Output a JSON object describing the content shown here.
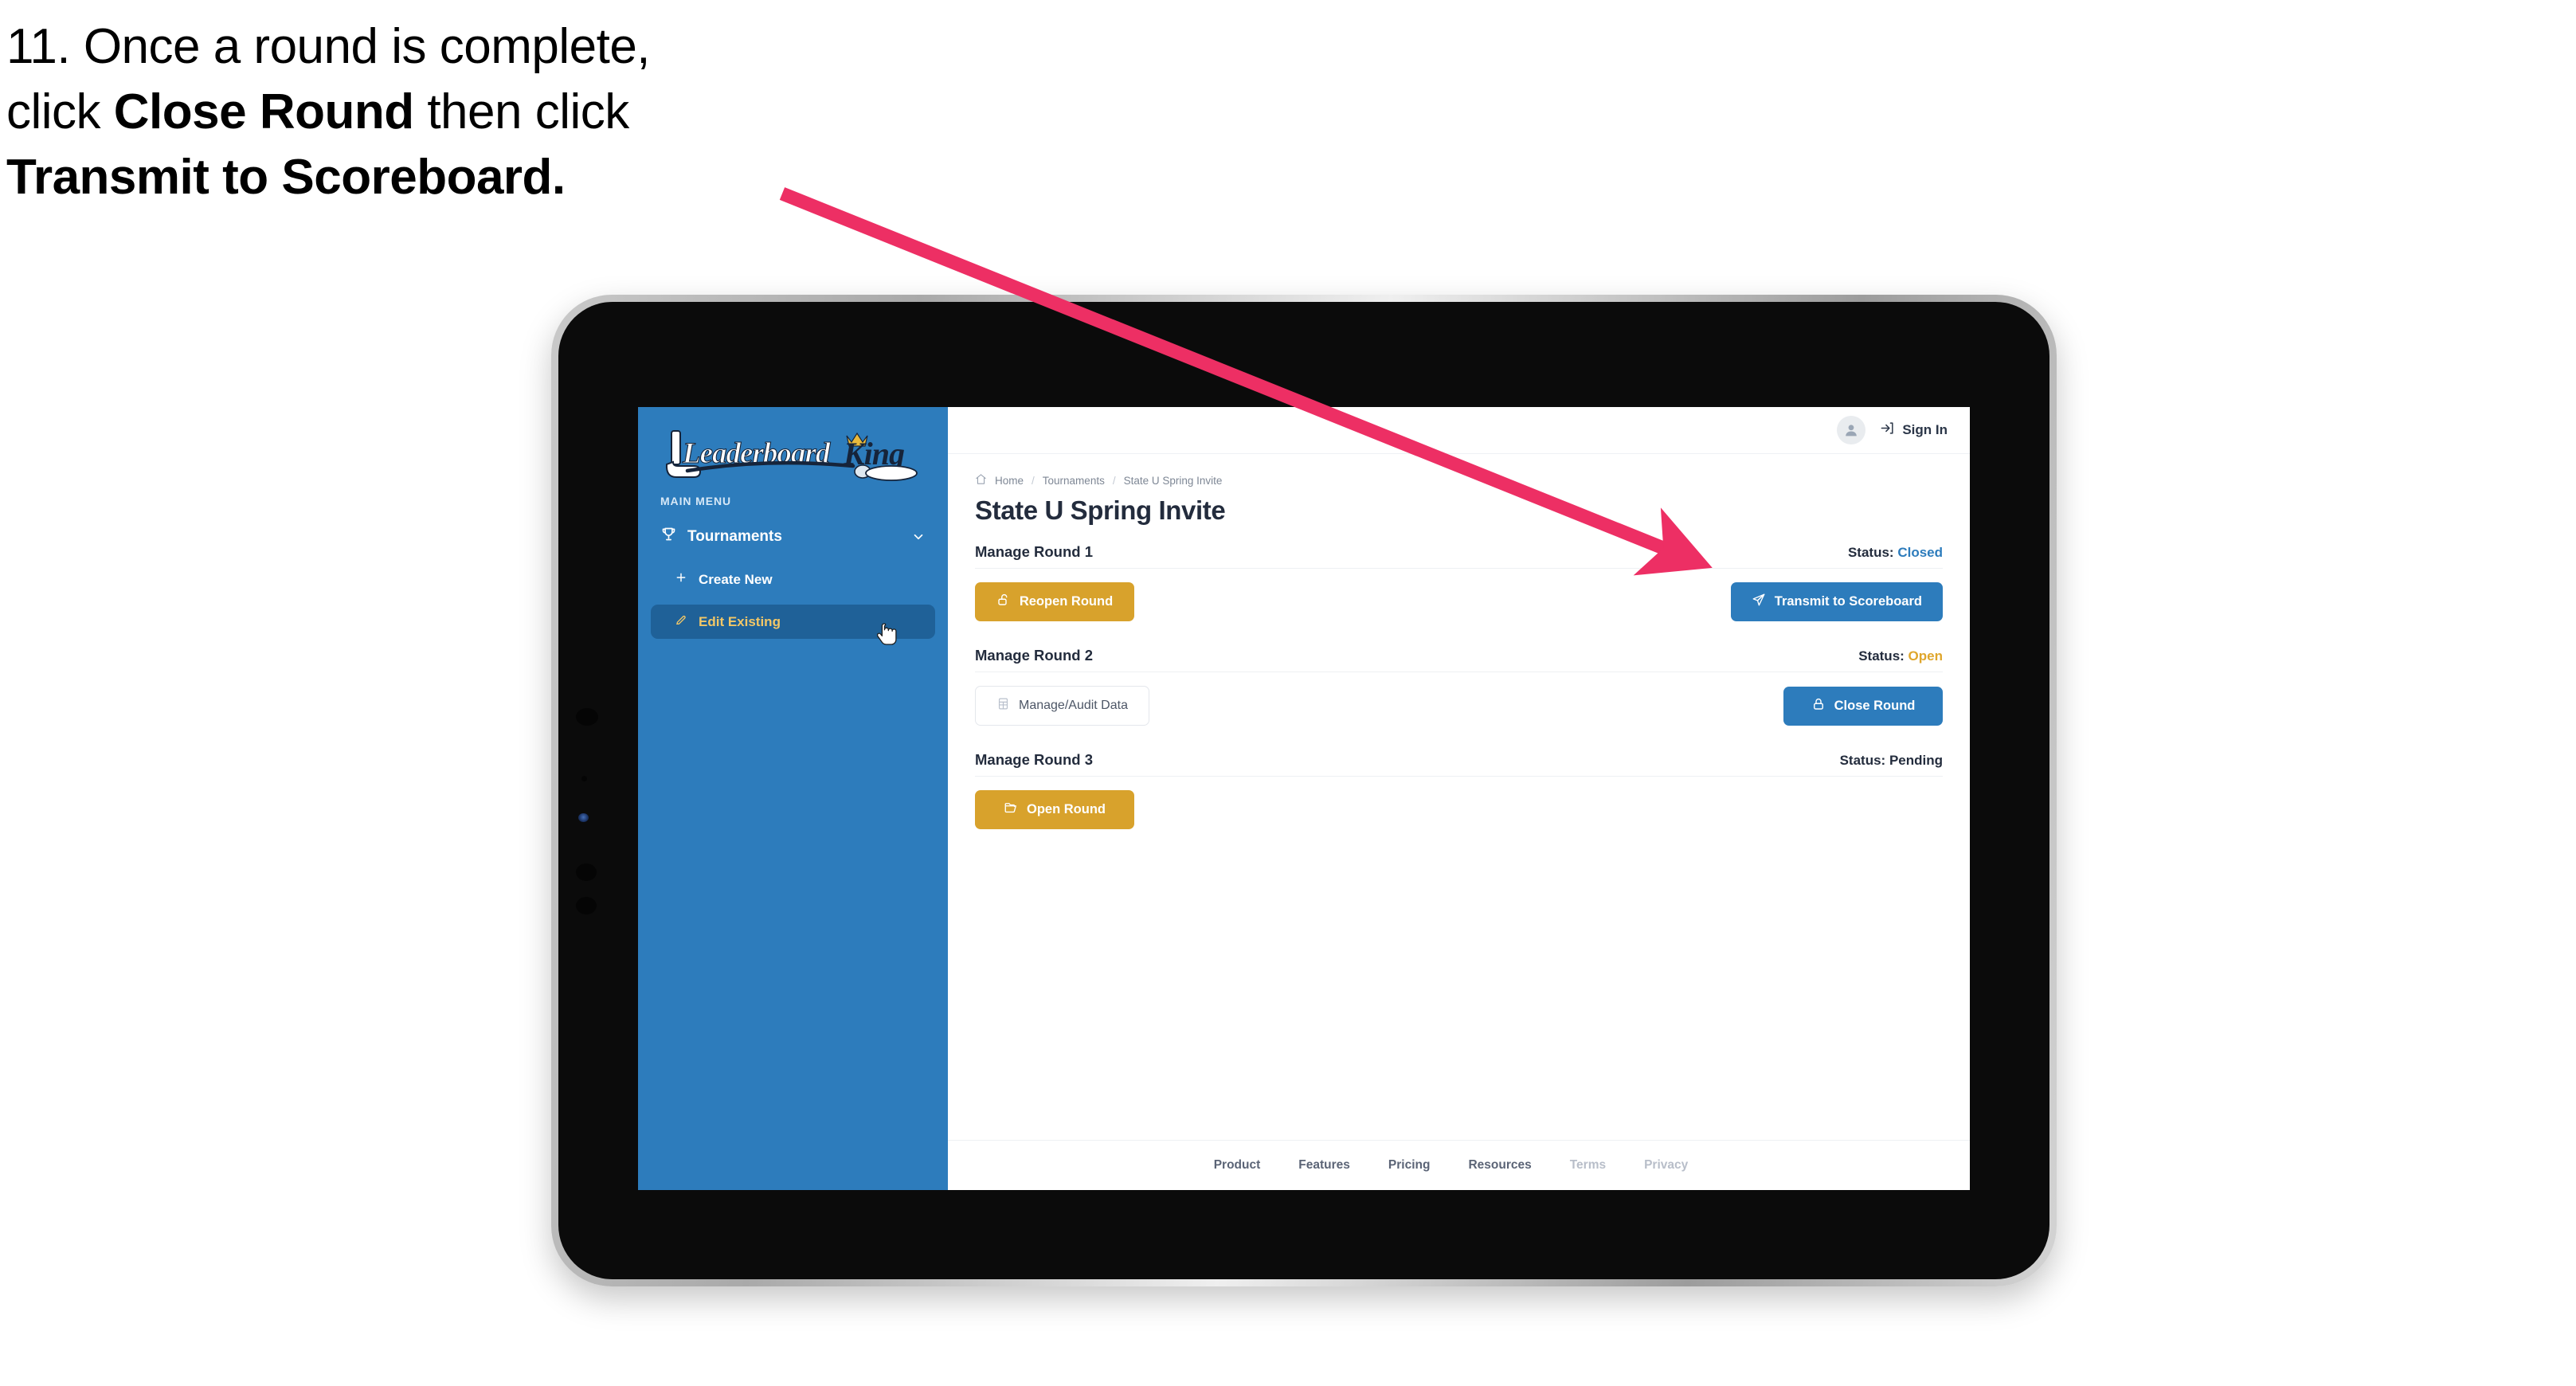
{
  "instruction": {
    "number": "11.",
    "line1_pre": "11. Once a round is complete,",
    "line2_pre": "click ",
    "line2_bold": "Close Round",
    "line2_post": " then click",
    "line3_bold": "Transmit to Scoreboard.",
    "arrow_color": "#ed2f64"
  },
  "app": {
    "brand": {
      "word_one": "Leaderboard",
      "word_two": "King",
      "sidebar_color": "#2d7cbc",
      "crown_color": "#e8b93c",
      "king_color": "#16243a"
    },
    "sidebar": {
      "section_label": "MAIN MENU",
      "items": [
        {
          "label": "Tournaments",
          "icon": "trophy-icon",
          "expanded": true
        },
        {
          "label": "Create New",
          "icon": "plus-icon",
          "active": false
        },
        {
          "label": "Edit Existing",
          "icon": "edit-pencil-icon",
          "active": true
        }
      ]
    },
    "topbar": {
      "avatar_icon": "user-avatar-icon",
      "signin_icon": "login-arrow-icon",
      "signin_label": "Sign In"
    },
    "breadcrumb": {
      "home_icon": "home-icon",
      "items": [
        "Home",
        "Tournaments",
        "State U Spring Invite"
      ],
      "separator": "/"
    },
    "page_title": "State U Spring Invite",
    "rounds": [
      {
        "title": "Manage Round 1",
        "status_label": "Status:",
        "status_value": "Closed",
        "status_kind": "closed",
        "primary": {
          "label": "Reopen Round",
          "icon": "unlock-icon",
          "style": "gold"
        },
        "secondary": {
          "label": "Transmit to Scoreboard",
          "icon": "paper-plane-icon",
          "style": "blue"
        }
      },
      {
        "title": "Manage Round 2",
        "status_label": "Status:",
        "status_value": "Open",
        "status_kind": "open",
        "primary": {
          "label": "Manage/Audit Data",
          "icon": "table-grid-icon",
          "style": "ghost"
        },
        "secondary": {
          "label": "Close Round",
          "icon": "lock-icon",
          "style": "blue"
        }
      },
      {
        "title": "Manage Round 3",
        "status_label": "Status:",
        "status_value": "Pending",
        "status_kind": "pending",
        "primary": {
          "label": "Open Round",
          "icon": "open-folder-icon",
          "style": "gold"
        },
        "secondary": null
      }
    ],
    "footer": {
      "links": [
        {
          "label": "Product",
          "muted": false
        },
        {
          "label": "Features",
          "muted": false
        },
        {
          "label": "Pricing",
          "muted": false
        },
        {
          "label": "Resources",
          "muted": false
        },
        {
          "label": "Terms",
          "muted": true
        },
        {
          "label": "Privacy",
          "muted": true
        }
      ]
    }
  },
  "colors": {
    "brand_blue": "#2d7cbc",
    "gold": "#d8a22c",
    "status_open": "#dfa62c",
    "status_closed": "#2d7cbc",
    "text_dark": "#232c3d",
    "annotation_pink": "#ed2f64"
  }
}
